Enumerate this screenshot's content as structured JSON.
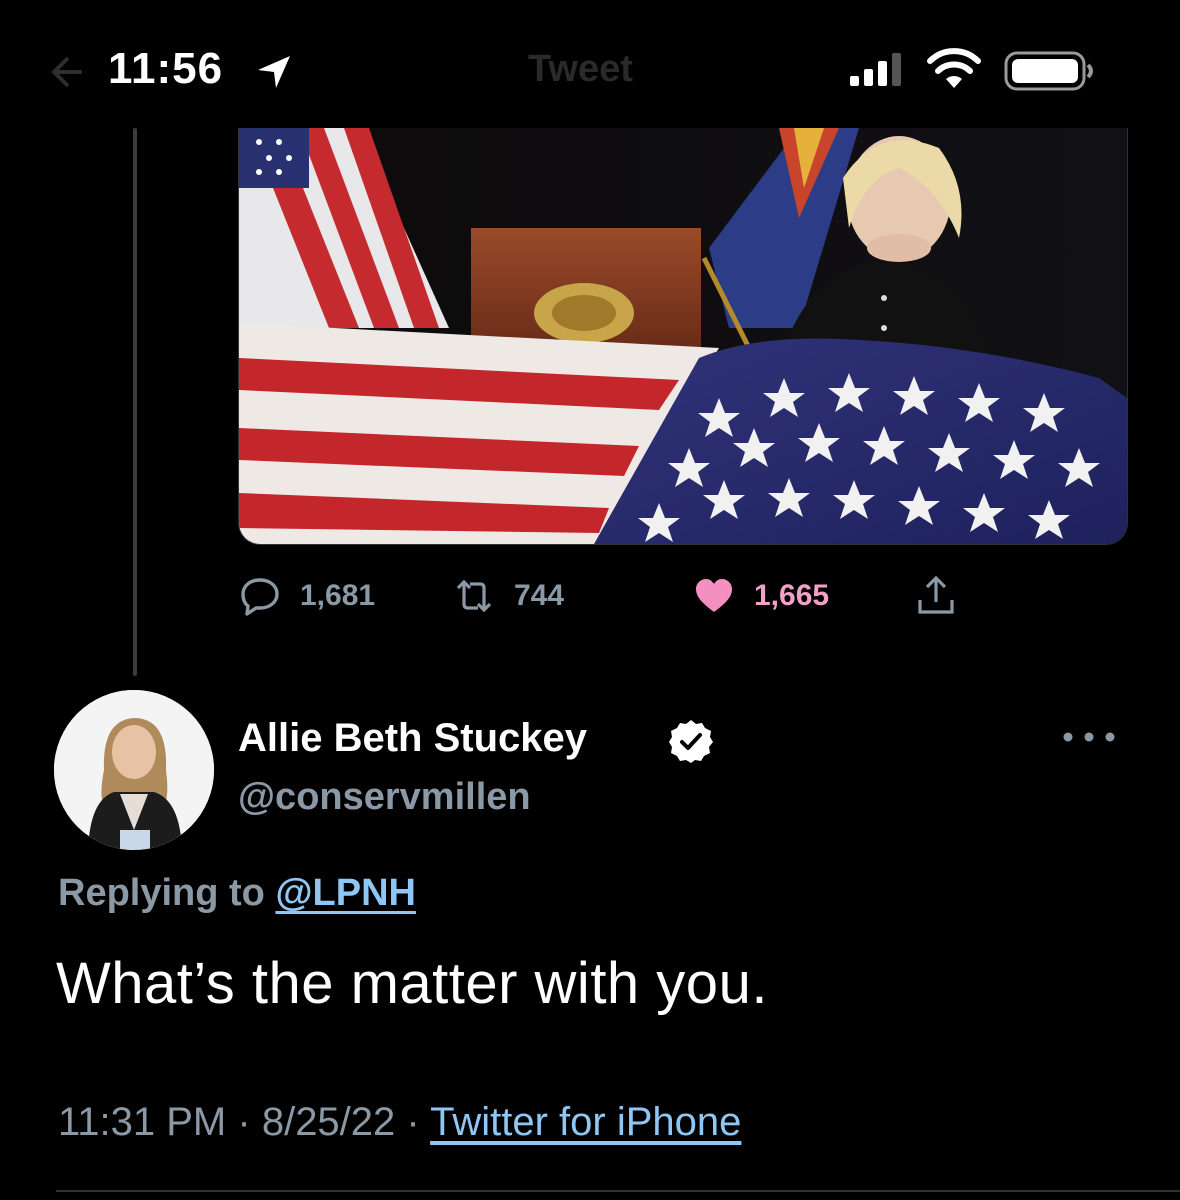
{
  "status_bar": {
    "time": "11:56",
    "nav_title": "Tweet"
  },
  "parent_tweet": {
    "stats": {
      "replies": "1,681",
      "retweets": "744",
      "likes": "1,665"
    }
  },
  "tweet": {
    "author_name": "Allie Beth Stuckey",
    "handle": "@conservmillen",
    "replying_prefix": "Replying to",
    "replying_to": "@LPNH",
    "text": "What’s the matter with you.",
    "time": "11:31 PM",
    "separator": "·",
    "date": "8/25/22",
    "client": "Twitter for iPhone"
  },
  "colors": {
    "background": "#000000",
    "secondary_text": "#8b98a5",
    "link": "#8ec7f5",
    "like": "#f48fc1"
  }
}
